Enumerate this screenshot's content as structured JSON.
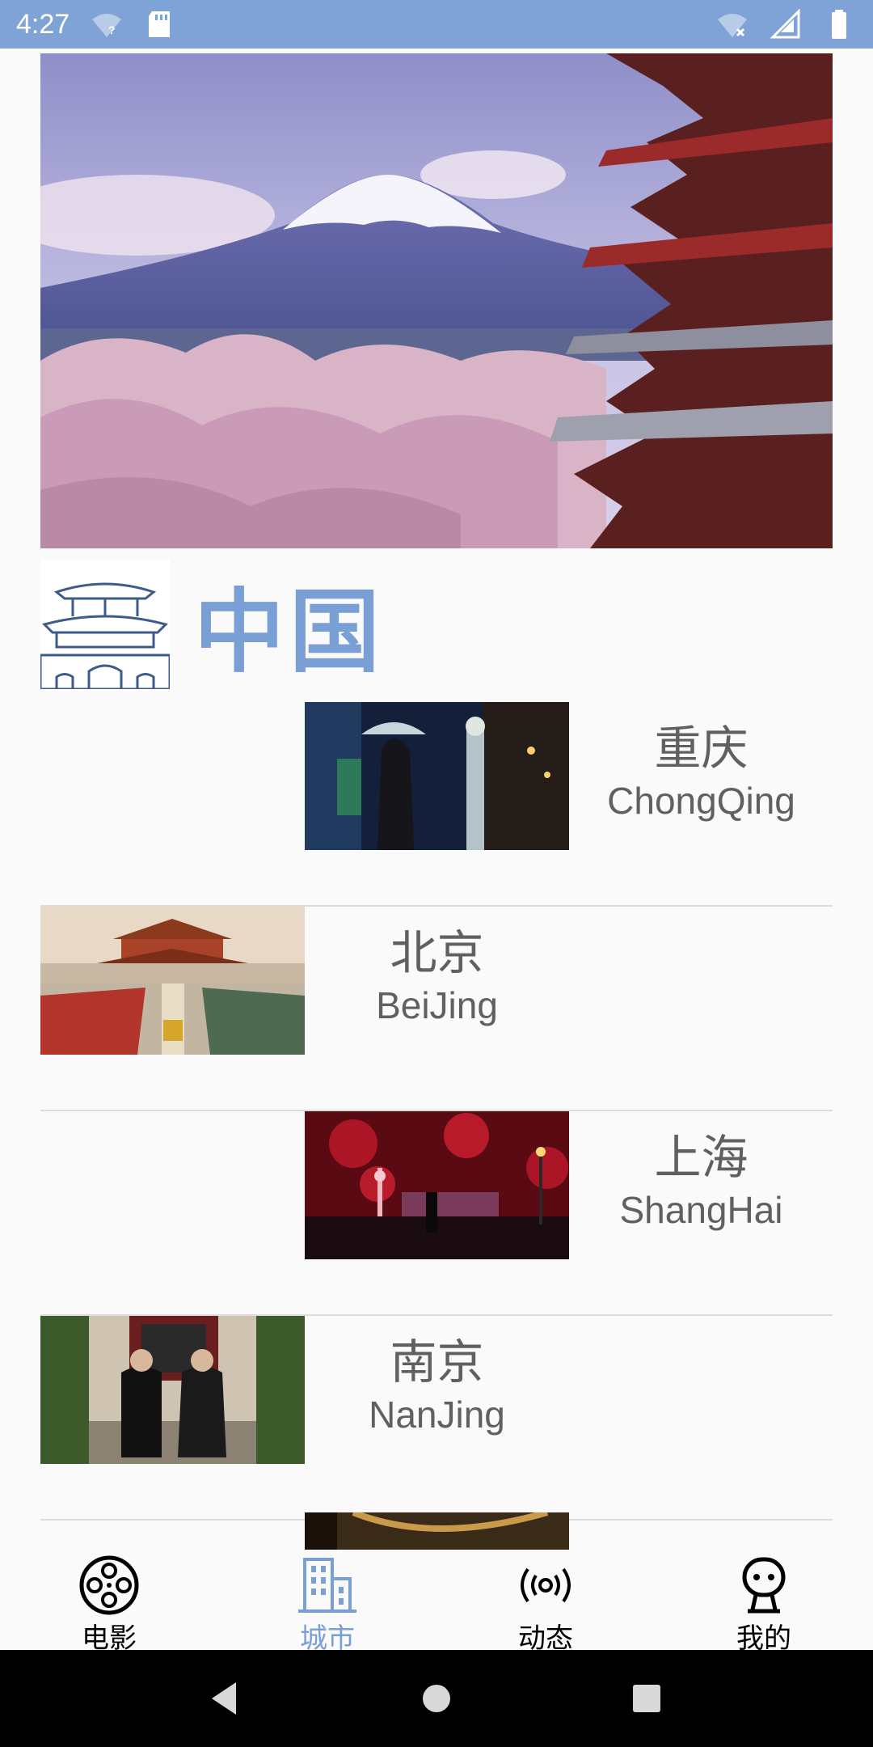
{
  "status_bar": {
    "time": "4:27",
    "left_icons": [
      "wifi-question-icon",
      "sd-card-icon"
    ],
    "right_icons": [
      "wifi-off-icon",
      "signal-icon",
      "battery-icon"
    ]
  },
  "section": {
    "title": "中国"
  },
  "cities": [
    {
      "cn": "重庆",
      "en": "ChongQing",
      "image_side": "left-offset"
    },
    {
      "cn": "北京",
      "en": "BeiJing",
      "image_side": "left"
    },
    {
      "cn": "上海",
      "en": "ShangHai",
      "image_side": "left-offset"
    },
    {
      "cn": "南京",
      "en": "NanJing",
      "image_side": "left"
    },
    {
      "cn": "",
      "en": "",
      "image_side": "left-offset"
    }
  ],
  "bottom_nav": {
    "items": [
      {
        "label": "电影",
        "icon": "film-reel-icon",
        "active": false
      },
      {
        "label": "城市",
        "icon": "city-building-icon",
        "active": true
      },
      {
        "label": "动态",
        "icon": "broadcast-icon",
        "active": false
      },
      {
        "label": "我的",
        "icon": "robot-face-icon",
        "active": false
      }
    ]
  },
  "colors": {
    "status_bar": "#7fa3d6",
    "accent": "#7a9fd4",
    "text_gray": "#606060",
    "divider": "#dcdcdc"
  }
}
